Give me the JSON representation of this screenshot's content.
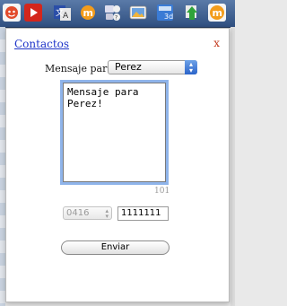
{
  "toolbar": {
    "icons": [
      "avatar-icon",
      "play-icon",
      "translate-icon",
      "orange-m-icon",
      "contact-card-icon",
      "photo-icon",
      "calendar-3d-icon",
      "green-arrow-icon",
      "orange-m-active-icon"
    ],
    "calendar_label": "3d"
  },
  "popup": {
    "contacts_link": "Contactos",
    "close_label": "x",
    "to_label": "Mensaje para:",
    "to_selected": "Perez",
    "message_text": "Mensaje para Perez!",
    "char_count": "101",
    "prefix_selected": "0416",
    "phone_value": "1111111",
    "send_label": "Enviar"
  },
  "colors": {
    "link": "#1f35c9",
    "close": "#c43a1d",
    "focus_ring": "#8fb4ea",
    "toolbar": "#3a5a8c"
  }
}
